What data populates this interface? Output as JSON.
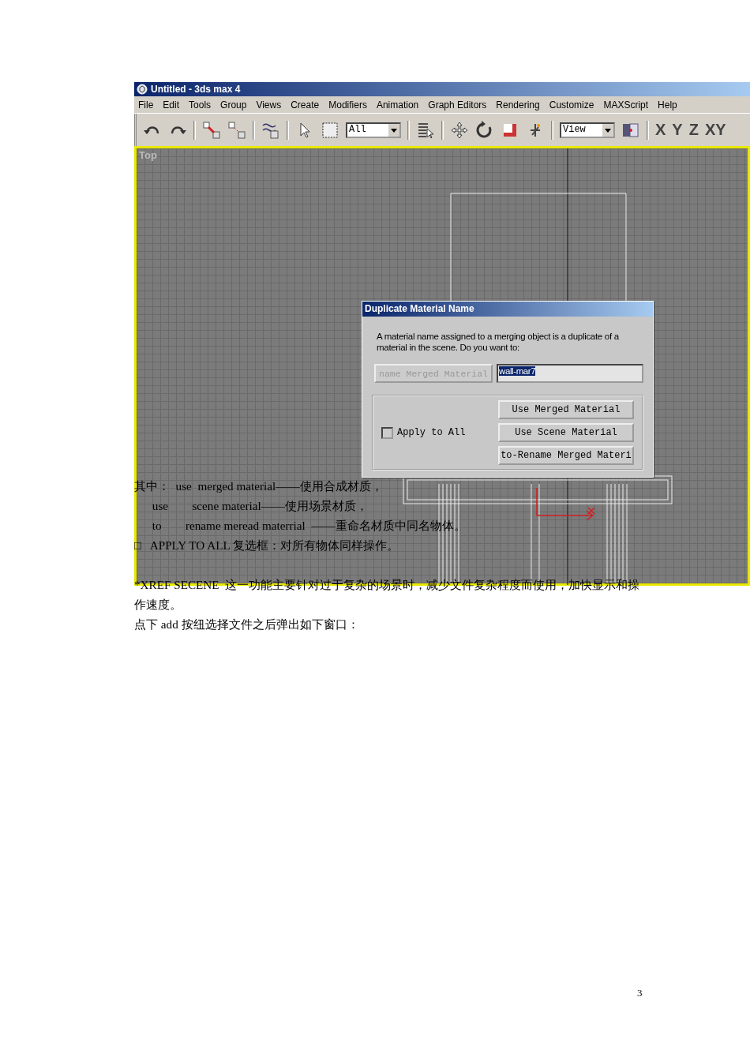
{
  "window": {
    "title": "Untitled - 3ds max 4"
  },
  "menu": [
    "File",
    "Edit",
    "Tools",
    "Group",
    "Views",
    "Create",
    "Modifiers",
    "Animation",
    "Graph Editors",
    "Rendering",
    "Customize",
    "MAXScript",
    "Help"
  ],
  "toolbar": {
    "selection_filter": "All",
    "reference_coord": "View",
    "axis_buttons": [
      "X",
      "Y",
      "Z",
      "XY"
    ]
  },
  "viewport": {
    "label": "Top",
    "active": true
  },
  "dialog": {
    "title": "Duplicate Material Name",
    "message": "A material name assigned to a merging object is a duplicate of a material in the scene. Do you want to:",
    "rename_button": {
      "label": "name Merged Material",
      "disabled": true
    },
    "rename_field": "wall-mar7",
    "apply_to_all": {
      "label": "Apply to All",
      "checked": false
    },
    "buttons": [
      "Use Merged Material",
      "Use Scene Material",
      "to-Rename Merged Materi"
    ]
  },
  "document": {
    "paragraphs": [
      "其中：  use  merged material——使用合成材质，",
      "      use        scene material——使用场景材质，",
      "      to        rename meread materrial  ——重命名材质中同名物体。",
      "□   APPLY TO ALL 复选框：对所有物体同样操作。",
      "*XREF SECENE  这一功能主要针对过于复杂的场景时，减少文件复杂程度而使用，加快显示和操作速度。",
      "点下 add 按纽选择文件之后弹出如下窗口："
    ]
  },
  "page_number": "3"
}
